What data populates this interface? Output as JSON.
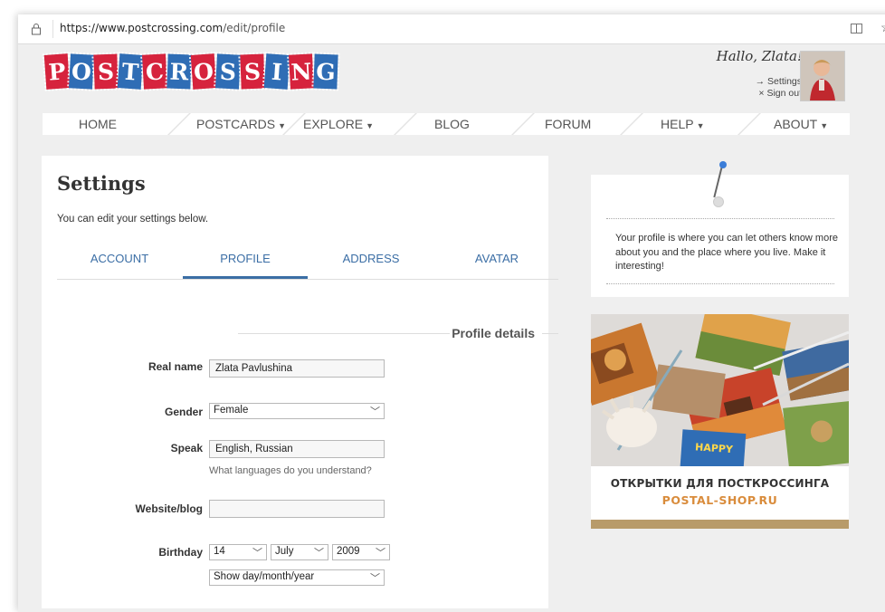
{
  "browser": {
    "url_host": "https://www.postcrossing.com",
    "url_path": "/edit/profile"
  },
  "header": {
    "logo_letters": [
      "P",
      "O",
      "S",
      "T",
      "C",
      "R",
      "O",
      "S",
      "S",
      "I",
      "N",
      "G"
    ],
    "greeting": "Hallo, Zlata!",
    "settings_link": "→ Settings",
    "signout_link": "× Sign out"
  },
  "nav": [
    {
      "label": "HOME",
      "caret": false
    },
    {
      "label": "POSTCARDS",
      "caret": true
    },
    {
      "label": "EXPLORE",
      "caret": true
    },
    {
      "label": "BLOG",
      "caret": false
    },
    {
      "label": "FORUM",
      "caret": false
    },
    {
      "label": "HELP",
      "caret": true
    },
    {
      "label": "ABOUT",
      "caret": true
    }
  ],
  "page": {
    "title": "Settings",
    "intro": "You can edit your settings below.",
    "tabs": [
      "ACCOUNT",
      "PROFILE",
      "ADDRESS",
      "AVATAR"
    ],
    "active_tab": "PROFILE",
    "section_title": "Profile details"
  },
  "form": {
    "real_name_label": "Real name",
    "real_name_value": "Zlata Pavlushina",
    "gender_label": "Gender",
    "gender_value": "Female",
    "speak_label": "Speak",
    "speak_value": "English, Russian",
    "speak_hint": "What languages do you understand?",
    "website_label": "Website/blog",
    "website_value": "",
    "birthday_label": "Birthday",
    "birthday_day": "14",
    "birthday_month": "July",
    "birthday_year": "2009",
    "birthday_visibility": "Show day/month/year"
  },
  "sidebar": {
    "tip": "Your profile is where you can let others know more about you and the place where you live. Make it interesting!",
    "ad_line1": "ОТКРЫТКИ ДЛЯ ПОСТКРОССИНГА",
    "ad_line2": "POSTAL-SHOP.RU"
  },
  "colors": {
    "logo_red": "#d6233d",
    "logo_blue": "#2f6db5",
    "link_blue": "#3b6ea5",
    "ad_accent": "#d98c3c"
  }
}
